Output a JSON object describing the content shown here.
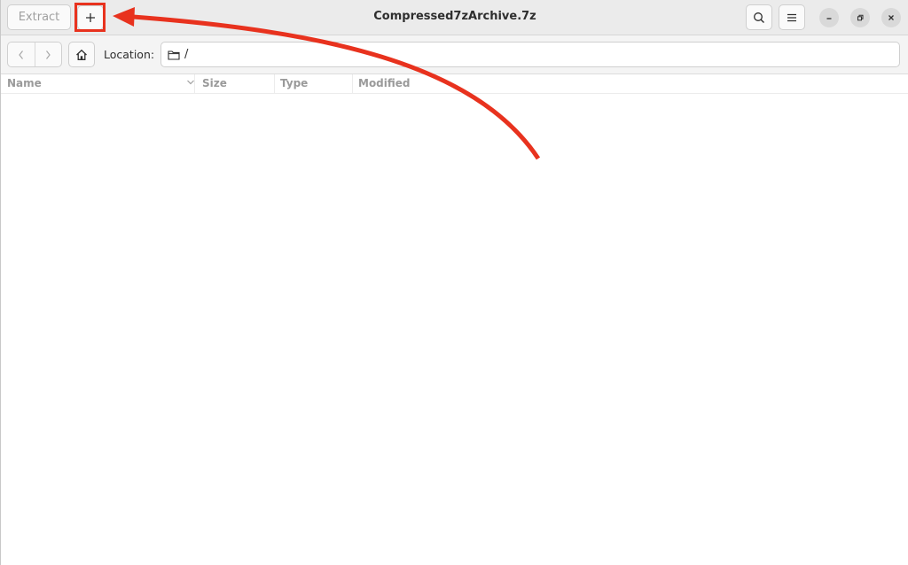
{
  "window": {
    "title": "Compressed7zArchive.7z"
  },
  "headerbar": {
    "extract_label": "Extract",
    "add_icon": "plus-icon",
    "search_icon": "search-icon",
    "menu_icon": "hamburger-menu-icon"
  },
  "locationbar": {
    "label": "Location:",
    "path": "/",
    "folder_icon": "folder-icon"
  },
  "columns": {
    "name": "Name",
    "size": "Size",
    "type": "Type",
    "modified": "Modified"
  },
  "annotation": {
    "color": "#e8321e"
  },
  "colors": {
    "headerbar_bg": "#ebebeb",
    "accent_red": "#e8321e"
  }
}
